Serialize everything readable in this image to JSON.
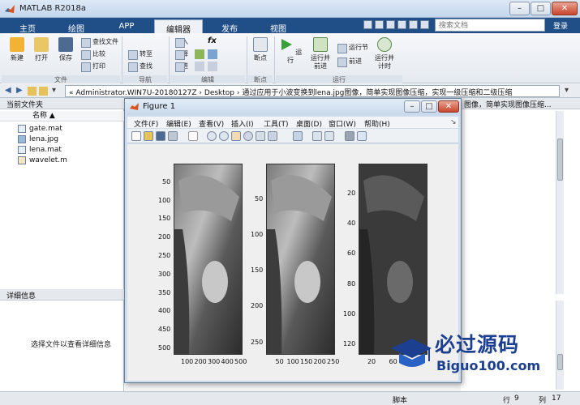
{
  "window": {
    "title": "MATLAB R2018a"
  },
  "tabs": [
    {
      "label": "主页"
    },
    {
      "label": "绘图"
    },
    {
      "label": "APP"
    },
    {
      "label": "编辑器"
    },
    {
      "label": "发布"
    },
    {
      "label": "视图"
    }
  ],
  "search": {
    "placeholder": "搜索文档"
  },
  "login": "登录",
  "ribbon": {
    "file_group": "文件",
    "nav_group": "导航",
    "edit_group": "编辑",
    "breakpoint_group": "断点",
    "run_group": "运行",
    "new": "新建",
    "open": "打开",
    "save": "保存",
    "find_files": "查找文件",
    "compare": "比较",
    "print": "打印",
    "goto": "转至",
    "find": "查找",
    "insert": "插入",
    "comment": "注释",
    "indent": "缩进",
    "fx": "fx",
    "breakpoint": "断点",
    "run": "运行",
    "run_advance": [
      "运行并",
      "前进"
    ],
    "run_section": "运行节",
    "advance": "前进",
    "run_time": [
      "运行并",
      "计时"
    ]
  },
  "address": "« Administrator.WIN7U-20180127Z  ›  Desktop  ›  通过应用于小波变换到lena.jpg图像，简单实现图像压缩，实现一级压缩和二级压缩",
  "left_panel": {
    "header": "当前文件夹",
    "column": "名称 ▲",
    "files": [
      {
        "name": "gate.mat",
        "type": "mat"
      },
      {
        "name": "lena.jpg",
        "type": "jpg"
      },
      {
        "name": "lena.mat",
        "type": "mat"
      },
      {
        "name": "wavelet.m",
        "type": "m"
      }
    ],
    "details_header": "详细信息",
    "details_empty": "选择文件以查看详细信息"
  },
  "right_panel": {
    "header": "图像，简单实现图像压缩..."
  },
  "status": {
    "script": "脚本",
    "row_label": "行",
    "row": "9",
    "col_label": "列",
    "col": "17"
  },
  "figure": {
    "title": "Figure 1",
    "menus": [
      "文件(F)",
      "编辑(E)",
      "查看(V)",
      "插入(I)",
      "工具(T)",
      "桌面(D)",
      "窗口(W)",
      "帮助(H)"
    ],
    "plots": [
      {
        "yticks": [
          "50",
          "100",
          "150",
          "200",
          "250",
          "300",
          "350",
          "400",
          "450",
          "500"
        ],
        "xticks": [
          "100",
          "200",
          "300",
          "400",
          "500"
        ]
      },
      {
        "yticks": [
          "50",
          "100",
          "150",
          "200",
          "250"
        ],
        "xticks": [
          "50",
          "100",
          "150",
          "200",
          "250"
        ]
      },
      {
        "yticks": [
          "20",
          "40",
          "60",
          "80",
          "100",
          "120"
        ],
        "xticks": [
          "20",
          "60"
        ]
      }
    ]
  },
  "watermark": {
    "brand": "必过源码",
    "url": "Biguo100.com"
  },
  "colors": {
    "accent": "#1f4f86",
    "ribbon": "#eef1f5",
    "figure_frame": "#cfdced"
  }
}
